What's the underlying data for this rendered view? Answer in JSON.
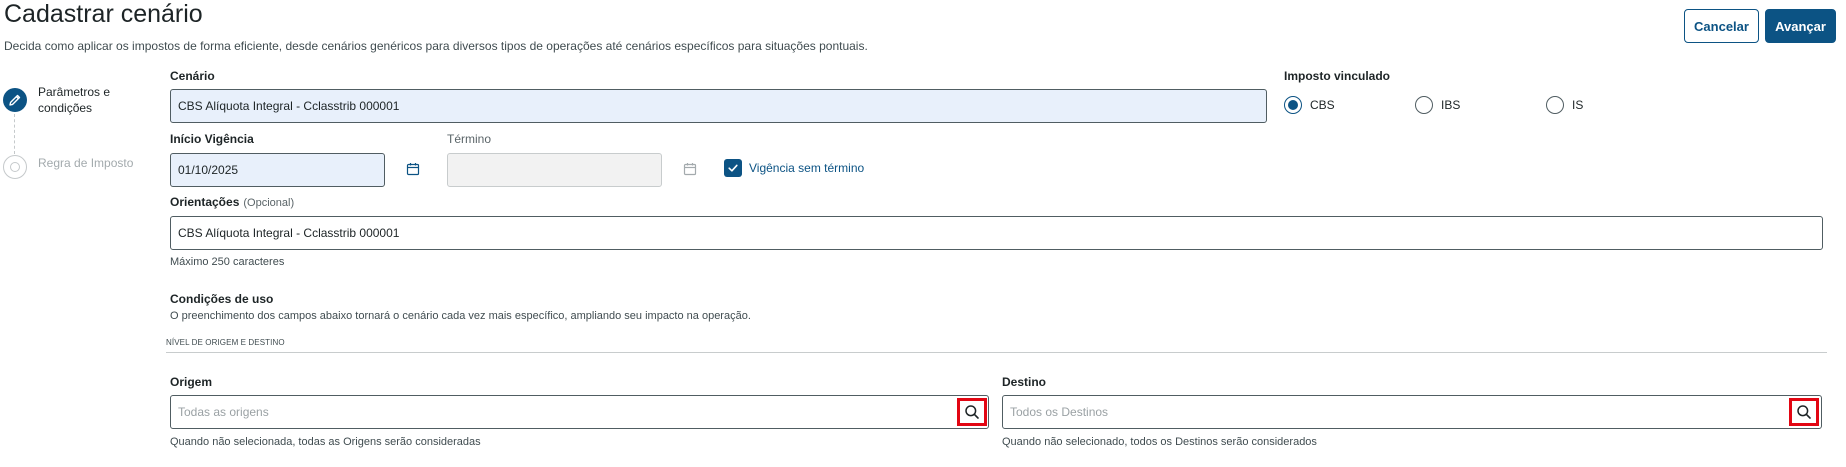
{
  "header": {
    "title": "Cadastrar cenário",
    "subtitle": "Decida como aplicar os impostos de forma eficiente, desde cenários genéricos para diversos tipos de operações até cenários específicos para situações pontuais.",
    "cancel_label": "Cancelar",
    "next_label": "Avançar"
  },
  "stepper": {
    "steps": [
      {
        "label": "Parâmetros e condições",
        "state": "active",
        "icon": "pencil-icon"
      },
      {
        "label": "Regra de Imposto",
        "state": "inactive",
        "icon": "circle-icon"
      }
    ]
  },
  "form": {
    "scenario": {
      "label": "Cenário",
      "value": "CBS Alíquota Integral - Cclasstrib 000001"
    },
    "linked_tax": {
      "label": "Imposto vinculado",
      "options": [
        "CBS",
        "IBS",
        "IS"
      ],
      "selected": "CBS"
    },
    "start_date": {
      "label": "Início Vigência",
      "value": "01/10/2025",
      "icon": "calendar-icon"
    },
    "end_date": {
      "label": "Término",
      "value": "",
      "icon": "calendar-icon"
    },
    "no_end": {
      "label": "Vigência sem término",
      "checked": true
    },
    "guidance": {
      "label": "Orientações",
      "optional": "(Opcional)",
      "value": "CBS Alíquota Integral - Cclasstrib 000001",
      "helper": "Máximo 250 caracteres"
    }
  },
  "conditions": {
    "title": "Condições de uso",
    "description": "O preenchimento dos campos abaixo tornará o cenário cada vez mais específico, ampliando seu impacto na operação.",
    "level_caption": "NÍVEL DE ORIGEM E DESTINO",
    "origin": {
      "label": "Origem",
      "placeholder": "Todas as origens",
      "helper": "Quando não selecionada, todas as Origens serão consideradas",
      "icon": "search-icon"
    },
    "destination": {
      "label": "Destino",
      "placeholder": "Todos os Destinos",
      "helper": "Quando não selecionado, todos os Destinos serão considerados",
      "icon": "search-icon"
    }
  },
  "colors": {
    "primary": "#0c5384",
    "highlight_border": "#e20613",
    "filled_field_bg": "#e8f0fb"
  }
}
